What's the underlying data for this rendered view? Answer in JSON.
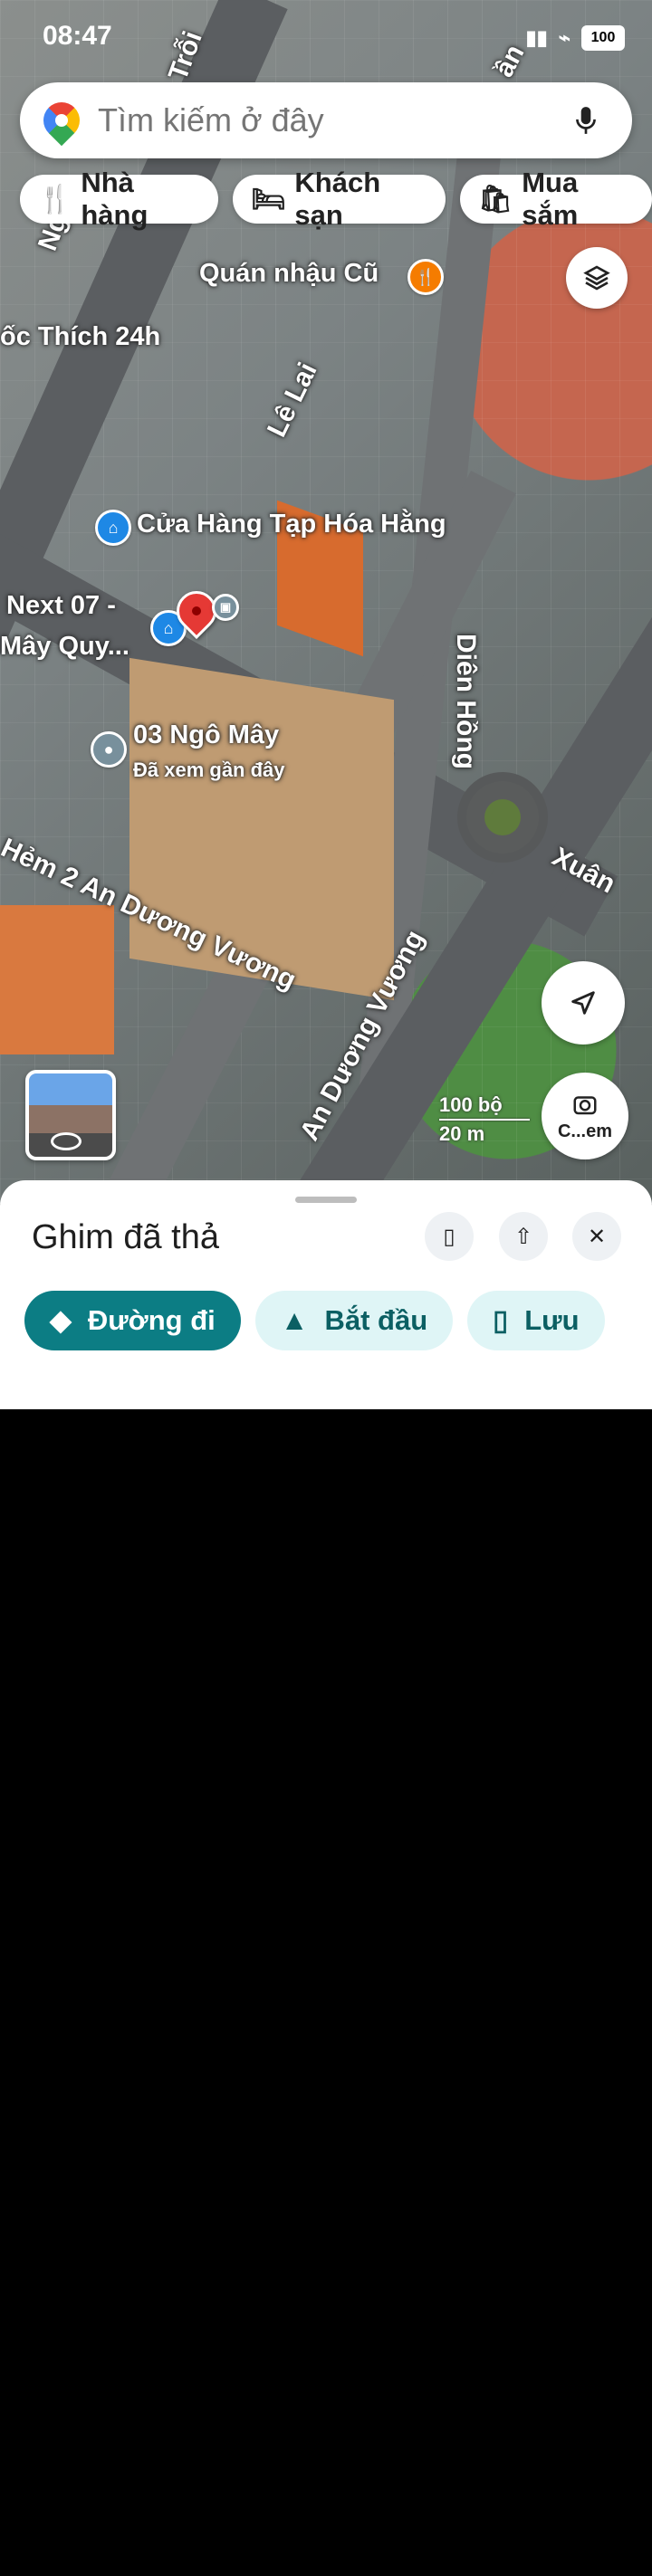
{
  "status": {
    "time": "08:47",
    "battery": "100"
  },
  "search": {
    "placeholder": "Tìm kiếm ở đây"
  },
  "chips": [
    {
      "label": "Nhà hàng",
      "icon": "restaurant-icon"
    },
    {
      "label": "Khách sạn",
      "icon": "hotel-icon"
    },
    {
      "label": "Mua sắm",
      "icon": "shopping-icon"
    }
  ],
  "map": {
    "labels": {
      "quan_nhau": "Quán nhậu Cũ",
      "oc_thich": "ốc Thích 24h",
      "le_lai": "Lê Lai",
      "cua_hang": "Cửa Hàng Tạp Hóa Hằng",
      "next07": "Next 07 -",
      "may_quy": "Mây Quy...",
      "ngo_may": "03 Ngô Mây",
      "da_xem": "Đã xem gần đây",
      "dien_hong": "Diên Hồng",
      "hem2": "Hẻm 2 An Dương Vương",
      "an_duong_vuong": "An Dương Vương",
      "xuan": "Xuân",
      "ng": "Ng",
      "troi": "Trỗi",
      "an_top": "ần"
    },
    "scale": {
      "top": "100 bộ",
      "bottom": "20 m"
    },
    "lens_label": "C...em"
  },
  "sheet": {
    "title": "Ghim đã thả",
    "actions": [
      "Đường đi",
      "Bắt đầu",
      "Lưu"
    ]
  },
  "colors": {
    "primary": "#0c7d84",
    "secondary_bg": "#dff5f6",
    "pin_red": "#e53935"
  }
}
